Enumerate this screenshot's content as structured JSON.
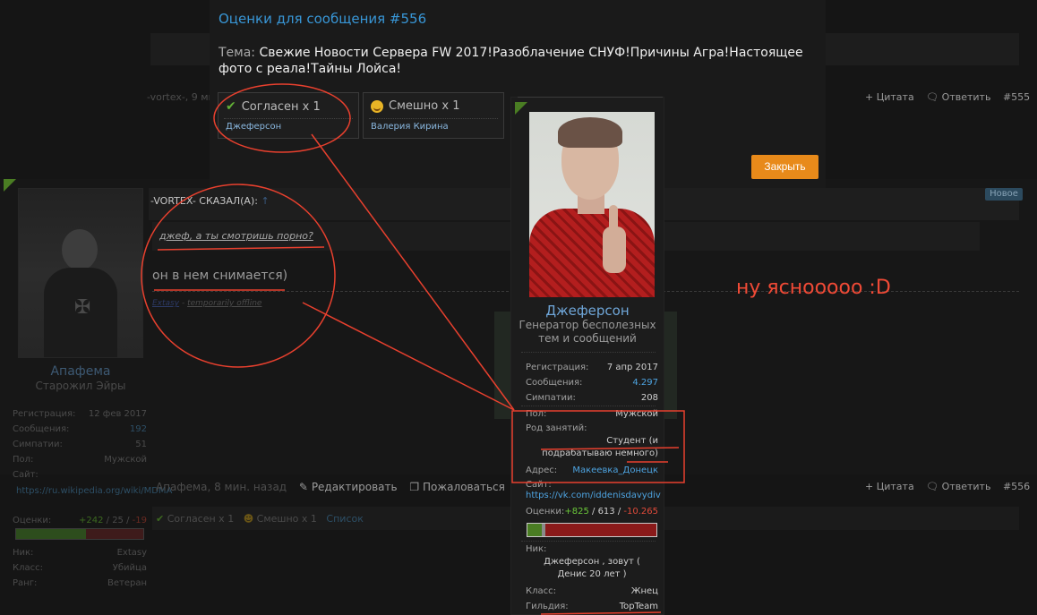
{
  "modal": {
    "title": "Оценки для сообщения #556",
    "topic_label": "Тема:",
    "topic": "Свежие Новости Сервера FW 2017!Разоблачение СНУФ!Причины Агра!Настоящее фото с реала!Тайны Лойса!",
    "ratings": [
      {
        "label": "Согласен x 1",
        "user": "Джеферсон",
        "icon": "check-icon"
      },
      {
        "label": "Смешно x 1",
        "user": "Валерия Кирина",
        "icon": "smile-icon"
      }
    ],
    "close_label": "Закрыть"
  },
  "post555": {
    "author_time": "-vortex-, 9 ми",
    "quote_label": "+ Цитата",
    "reply_label": "Ответить",
    "number": "#555"
  },
  "post556": {
    "new_badge": "Новое",
    "quote_author": "-VORTEX- СКАЗАЛ(А):",
    "quote_text": "джеф, а ты смотришь порно?",
    "reply_text": "он в нем снимается)",
    "sig_name": "Extasy",
    "sig_sep": " - ",
    "sig_status": "temporarily offline",
    "author_time": "Апафема, 8 мин. назад",
    "edit_label": "Редактировать",
    "report_label": "Пожаловаться",
    "quote_label": "+ Цитата",
    "reply_label": "Ответить",
    "number": "#556",
    "likes": {
      "agree": "Согласен x 1",
      "funny": "Смешно x 1",
      "list": "Список"
    }
  },
  "author1": {
    "name": "Апафема",
    "title": "Старожил Эйры",
    "reg_label": "Регистрация:",
    "reg": "12 фев 2017",
    "posts_label": "Сообщения:",
    "posts": "192",
    "likes_label": "Симпатии:",
    "likes": "51",
    "gender_label": "Пол:",
    "gender": "Мужской",
    "site_label": "Сайт:",
    "site": "https://ru.wikipedia.org/wiki/MDMA",
    "ratings_label": "Оценки:",
    "r_pos": "+242",
    "r_mid": " / 25 / ",
    "r_neg": "-19",
    "nick_label": "Ник:",
    "nick": "Extasy",
    "class_label": "Класс:",
    "class": "Убийца",
    "rank_label": "Ранг:",
    "rank": "Ветеран"
  },
  "card": {
    "name": "Джеферсон",
    "title": "Генератор бесполезных тем и сообщений",
    "reg_label": "Регистрация:",
    "reg": "7 апр 2017",
    "posts_label": "Сообщения:",
    "posts": "4.297",
    "likes_label": "Симпатии:",
    "likes": "208",
    "gender_label": "Пол:",
    "gender": "Мужской",
    "job_label": "Род занятий:",
    "job": "Студент (и подрабатываю немного)",
    "addr_label": "Адрес:",
    "addr": "Макеевка_Донецк",
    "site_label": "Сайт:",
    "site": "https://vk.com/iddenisdavydiv",
    "ratings_label": "Оценки:",
    "r_pos": "+825",
    "r_mid": " / 613 / ",
    "r_neg": "-10.265",
    "rating_bar": {
      "positive": 0.11,
      "neutral": 0.03
    },
    "nick_label": "Ник:",
    "nick": "Джеферсон , зовут ( Денис 20 лет )",
    "class_label": "Класс:",
    "class": "Жнец",
    "guild_label": "Гильдия:",
    "guild": "TopTeam"
  },
  "annotation": "ну ясноoooo :D",
  "colors": {
    "accent": "#3896d6",
    "button": "#e88a1a",
    "annotation": "#f04a36"
  }
}
